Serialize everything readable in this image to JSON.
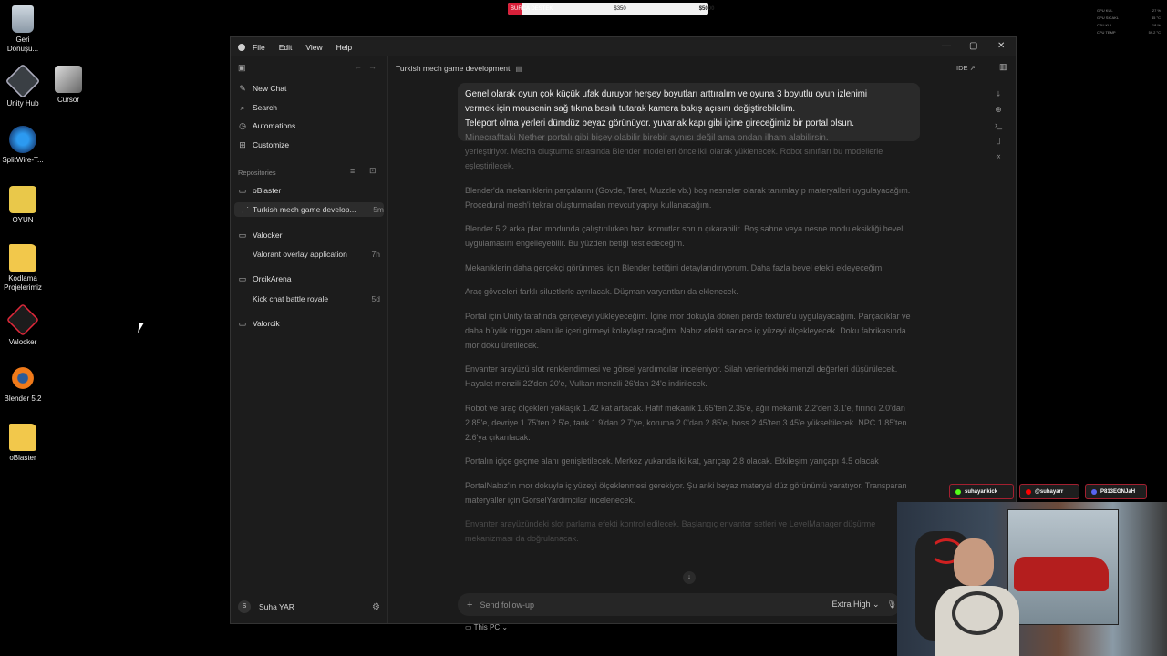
{
  "desktop": {
    "icons": [
      {
        "label": "Geri\nDönüşü..."
      },
      {
        "label": "Unity Hub"
      },
      {
        "label": "Cursor"
      },
      {
        "label": "SplitWire-T..."
      },
      {
        "label": "OYUN"
      },
      {
        "label": "Kodlama\nProjelerimiz"
      },
      {
        "label": "Valocker"
      },
      {
        "label": "Blender 5.2"
      },
      {
        "label": "oBlaster"
      }
    ]
  },
  "overlay": {
    "donation_label": "BURCA DESTEK",
    "donation_current": "$350",
    "donation_goal": "$5000",
    "donation_progress": 0.07,
    "hw_stats": [
      {
        "label": "GPU KUL",
        "value": "27 %"
      },
      {
        "label": "GPU SICAKL",
        "value": "45 °C"
      },
      {
        "label": "CPU KUL",
        "value": "18 %"
      },
      {
        "label": "CPU TEMP",
        "value": "59.2 °C"
      }
    ],
    "socials": [
      {
        "label": "suhayar.kick",
        "color": "#53fc18"
      },
      {
        "label": "@suhayarr",
        "color": "#ff0000"
      },
      {
        "label": "P813EGNJaH",
        "color": "#5865f2"
      }
    ]
  },
  "window": {
    "menu": [
      "File",
      "Edit",
      "View",
      "Help"
    ]
  },
  "sidebar": {
    "nav": [
      {
        "label": "New Chat",
        "icon": "edit-icon"
      },
      {
        "label": "Search",
        "icon": "search-icon"
      },
      {
        "label": "Automations",
        "icon": "clock-icon"
      },
      {
        "label": "Customize",
        "icon": "grid-icon"
      }
    ],
    "repos_heading": "Repositories",
    "repos": [
      {
        "name": "oBlaster",
        "threads": [
          {
            "title": "Turkish mech game develop...",
            "age": "5m"
          }
        ]
      },
      {
        "name": "Valocker",
        "threads": [
          {
            "title": "Valorant overlay application",
            "age": "7h"
          }
        ]
      },
      {
        "name": "OrcikArena",
        "threads": [
          {
            "title": "Kick chat battle royale",
            "age": "5d"
          }
        ]
      },
      {
        "name": "Valorcik",
        "threads": []
      }
    ],
    "user": {
      "initial": "S",
      "name": "Suha YAR"
    }
  },
  "main": {
    "thread_title": "Turkish mech game development",
    "ide_label": "IDE ↗",
    "user_message": {
      "line1": "Genel olarak oyun çok küçük ufak duruyor herşey boyutları arttıralım ve oyuna 3 boyutlu oyun izlenimi",
      "line2": "vermek için mousenin sağ tıkına basılı tutarak kamera bakış açısını değiştirebilelim.",
      "line3": "Teleport olma yerleri dümdüz beyaz görünüyor. yuvarlak kapı gibi içine gireceğimiz bir portal olsun.",
      "line4": "Minecrafttaki Nether portalı gibi bişey olabilir birebir aynısı değil ama ondan ilham alabilirsin."
    },
    "transcript": [
      "yerleştiriyor. Mecha oluşturma sırasında Blender modelleri öncelikli olarak yüklenecek. Robot sınıfları bu modellerle eşleştirilecek.",
      "Blender'da mekaniklerin parçalarını (Govde, Taret, Muzzle vb.) boş nesneler olarak tanımlayıp materyalleri uygulayacağım. Procedural mesh'i tekrar oluşturmadan mevcut yapıyı kullanacağım.",
      "Blender 5.2 arka plan modunda çalıştırılırken bazı komutlar sorun çıkarabilir. Boş sahne veya nesne modu eksikliği bevel uygulamasını engelleyebilir. Bu yüzden betiği test edeceğim.",
      "Mekaniklerin daha gerçekçi görünmesi için Blender betiğini detaylandırıyorum. Daha fazla bevel efekti ekleyeceğim.",
      "Araç gövdeleri farklı siluetlerle ayrılacak. Düşman varyantları da eklenecek.",
      "Portal için Unity tarafında çerçeveyi yükleyeceğim. İçine mor dokuyla dönen perde texture'u uygulayacağım. Parçacıklar ve daha büyük trigger alanı ile içeri girmeyi kolaylaştıracağım. Nabız efekti sadece iç yüzeyi ölçekleyecek. Doku fabrikasında mor doku üretilecek.",
      "Envanter arayüzü slot renklendirmesi ve görsel yardımcılar inceleniyor. Silah verilerindeki menzil değerleri düşürülecek. Hayalet menzili 22'den 20'e, Vulkan menzili 26'dan 24'e indirilecek.",
      "Robot ve araç ölçekleri yaklaşık 1.42 kat artacak. Hafif mekanik 1.65'ten 2.35'e, ağır mekanik 2.2'den 3.1'e, fırıncı 2.0'dan 2.85'e, devriye 1.75'ten 2.5'e, tank 1.9'dan 2.7'ye, koruma 2.0'dan 2.85'e, boss 2.45'ten 3.45'e yükseltilecek. NPC 1.85'ten 2.6'ya çıkarılacak.",
      "Portalın içiçe geçme alanı genişletilecek. Merkez yukarıda iki kat, yarıçap 2.8 olacak. Etkileşim yarıçapı 4.5 olacak",
      "PortalNabız'ın mor dokuyla iç yüzeyi ölçeklenmesi gerekiyor. Şu anki beyaz materyal düz görünümü yaratıyor. Transparan materyaller için GorselYardimcilar incelenecek.",
      "Envanter arayüzündeki slot parlama efekti kontrol edilecek. Başlangıç envanter setleri ve LevelManager düşürme mekanizması da doğrulanacak."
    ],
    "composer": {
      "placeholder": "Send follow-up",
      "effort": "Extra High ⌄",
      "environment": "This PC ⌄"
    }
  }
}
